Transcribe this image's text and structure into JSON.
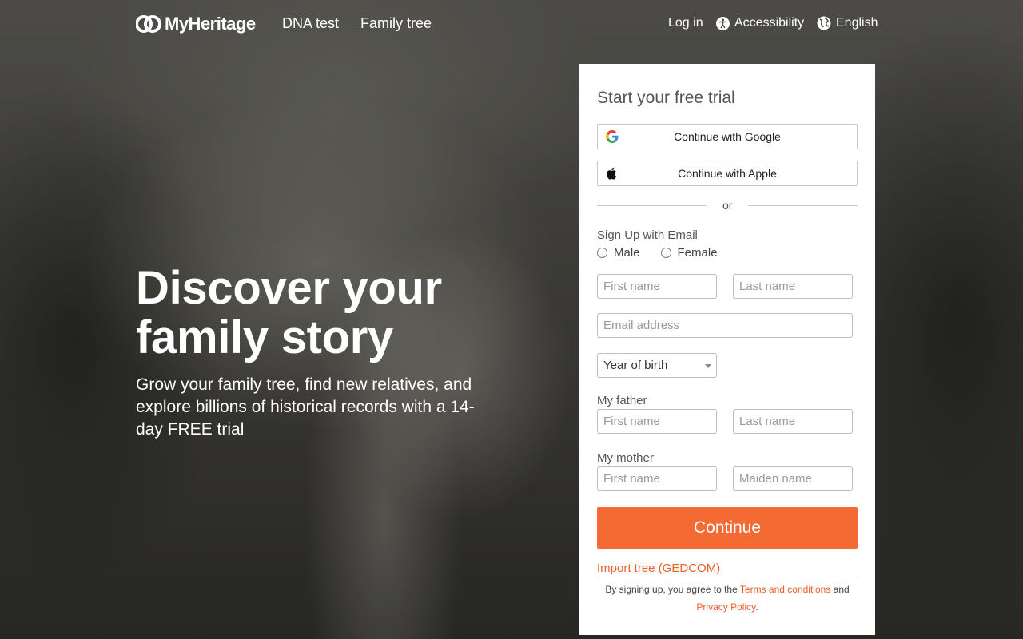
{
  "nav": {
    "logo_text": "MyHeritage",
    "dna_test": "DNA test",
    "family_tree": "Family tree",
    "login": "Log in",
    "accessibility": "Accessibility",
    "language": "English"
  },
  "hero": {
    "title_line1": "Discover your",
    "title_line2": "family story",
    "subtitle": "Grow your family tree, find new relatives, and explore billions of historical records with a 14-day FREE trial"
  },
  "signup": {
    "title": "Start your free trial",
    "google_label": "Continue with Google",
    "apple_label": "Continue with Apple",
    "or_label": "or",
    "email_section_label": "Sign Up with Email",
    "gender_options": [
      "Male",
      "Female"
    ],
    "first_name_placeholder": "First name",
    "last_name_placeholder": "Last name",
    "email_placeholder": "Email address",
    "year_of_birth_label": "Year of birth",
    "father_label": "My father",
    "father_first_placeholder": "First name",
    "father_last_placeholder": "Last name",
    "mother_label": "My mother",
    "mother_first_placeholder": "First name",
    "mother_maiden_placeholder": "Maiden name",
    "continue_label": "Continue",
    "import_label": "Import tree (GEDCOM)",
    "legal_prefix": "By signing up, you agree to the",
    "terms_label": "Terms and conditions",
    "legal_and": "and",
    "privacy_label": "Privacy Policy",
    "legal_suffix": "."
  },
  "colors": {
    "accent": "#f36b32",
    "link": "#e8602a",
    "panel_bg": "#ffffff"
  },
  "icons": {
    "logo": "myheritage-logo-icon",
    "accessibility": "accessibility-icon",
    "language": "globe-icon",
    "google": "google-icon",
    "apple": "apple-icon",
    "dropdown": "chevron-down-icon"
  }
}
